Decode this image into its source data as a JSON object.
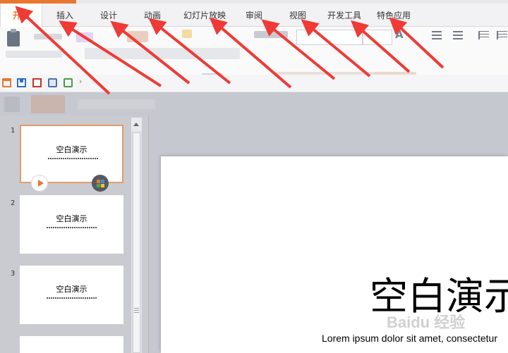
{
  "tabs": [
    {
      "label": "开始",
      "active": true
    },
    {
      "label": "插入"
    },
    {
      "label": "设计"
    },
    {
      "label": "动画"
    },
    {
      "label": "幻灯片放映"
    },
    {
      "label": "审阅"
    },
    {
      "label": "视图"
    },
    {
      "label": "开发工具"
    },
    {
      "label": "特色应用"
    }
  ],
  "ribbon": {
    "font_size_grow": "A"
  },
  "slides": [
    {
      "number": "1",
      "title": "空白演示",
      "selected": true
    },
    {
      "number": "2",
      "title": "空白演示"
    },
    {
      "number": "3",
      "title": "空白演示"
    }
  ],
  "editor": {
    "title": "空白演示",
    "subtitle": "Lorem ipsum dolor sit amet, consectetur"
  },
  "watermark": "Baidu 经验",
  "annotation": {
    "arrow_color": "#f03a36",
    "arrow_count": 9
  },
  "colors": {
    "accent": "#e9772f",
    "selected_border": "#e69a65"
  }
}
